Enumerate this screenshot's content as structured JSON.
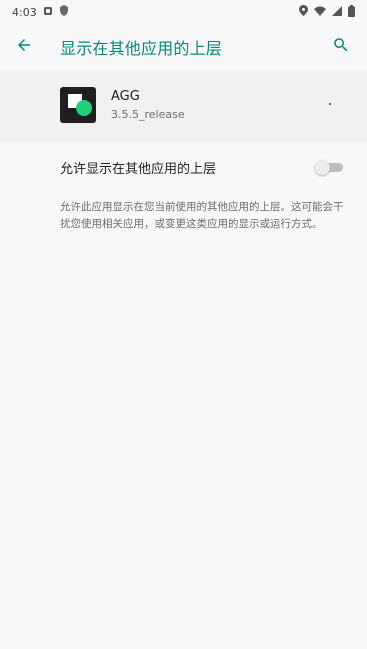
{
  "status_bar": {
    "time": "4:03",
    "left_icons": [
      "notification-icon",
      "shield-icon"
    ],
    "right_icons": [
      "location-icon",
      "wifi-icon",
      "signal-icon",
      "battery-icon"
    ]
  },
  "toolbar": {
    "title": "显示在其他应用的上层",
    "back_icon": "arrow-left-icon",
    "search_icon": "search-icon",
    "accent_color": "#00897b"
  },
  "app": {
    "name": "AGG",
    "version": "3.5.5_release"
  },
  "setting": {
    "label": "允许显示在其他应用的上层",
    "enabled": false
  },
  "description": "允许此应用显示在您当前使用的其他应用的上层。这可能会干扰您使用相关应用，或变更这类应用的显示或运行方式。"
}
